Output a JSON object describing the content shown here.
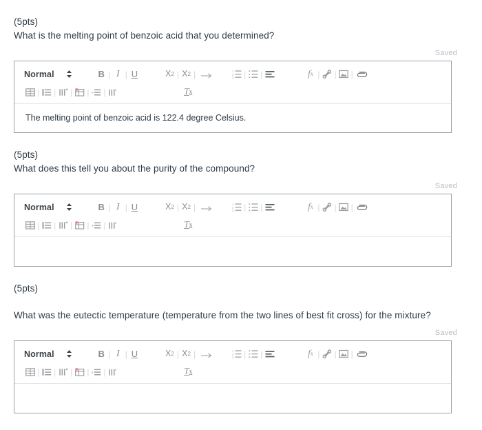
{
  "questions": [
    {
      "points": "(5pts)",
      "text": "What is the melting point of benzoic acid that you determined?",
      "saved_label": "Saved",
      "answer": "The melting point of benzoic acid is 122.4 degree Celsius.",
      "extra_spacing": false
    },
    {
      "points": "(5pts)",
      "text": "What does this tell you about the purity of the compound?",
      "saved_label": "Saved",
      "answer": "",
      "extra_spacing": false
    },
    {
      "points": "(5pts)",
      "text": "What was the eutectic temperature (temperature from the two lines of best fit cross) for the mixture?",
      "saved_label": "Saved",
      "answer": "",
      "extra_spacing": true
    }
  ],
  "toolbar": {
    "style_label": "Normal",
    "bold_label": "B",
    "italic_label": "I",
    "underline_label": "U",
    "subscript_label": "X",
    "subscript_index": "2",
    "superscript_label": "X",
    "superscript_index": "2",
    "formula_label": "f",
    "formula_index": "x",
    "clear_format_label": "T",
    "clear_format_index": "x",
    "separator": "|",
    "icons": {
      "style_chevron": "chevron-up-down-icon",
      "arrow": "right-arrow-icon",
      "numbered_list": "numbered-list-icon",
      "bulleted_list": "bulleted-list-icon",
      "align": "align-icon",
      "link": "link-icon",
      "image": "image-icon",
      "attachment": "paperclip-icon",
      "insert_table": "insert-table-icon",
      "insert_row": "insert-row-icon",
      "insert_column": "insert-column-icon",
      "delete_table": "delete-table-icon",
      "delete_row": "delete-row-icon",
      "delete_column": "delete-column-icon"
    }
  },
  "colors": {
    "text": "#2d3b45",
    "muted": "#b7bec4",
    "icon": "#8e9296",
    "border": "#9a9fa3",
    "divider": "#e3e5e7",
    "delete_accent": "#e8697d"
  }
}
